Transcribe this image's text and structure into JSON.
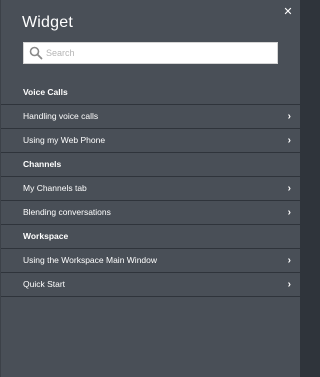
{
  "header": {
    "title": "Widget",
    "close_glyph": "✕"
  },
  "search": {
    "placeholder": "Search",
    "value": ""
  },
  "sections": [
    {
      "label": "Voice Calls",
      "items": [
        {
          "label": "Handling voice calls"
        },
        {
          "label": "Using my Web Phone"
        }
      ]
    },
    {
      "label": "Channels",
      "items": [
        {
          "label": "My Channels tab"
        },
        {
          "label": "Blending conversations"
        }
      ]
    },
    {
      "label": "Workspace",
      "items": [
        {
          "label": "Using the Workspace Main Window"
        },
        {
          "label": "Quick Start"
        }
      ]
    }
  ],
  "chevron_glyph": "›",
  "colors": {
    "panel_bg": "#494f57",
    "divider": "#2f343b",
    "text": "#ffffff"
  }
}
